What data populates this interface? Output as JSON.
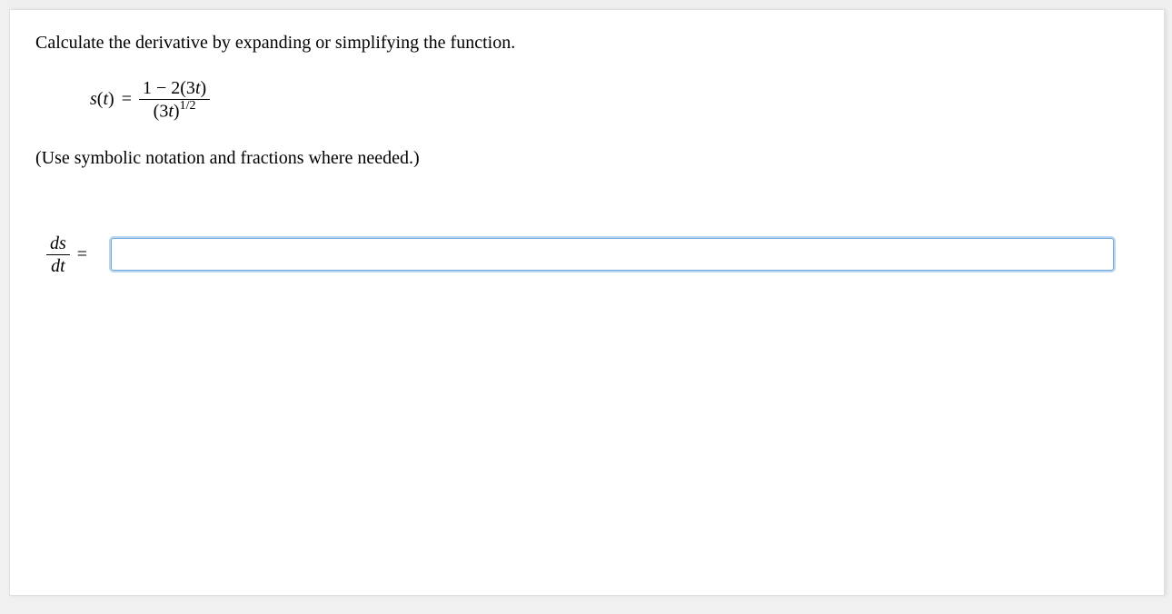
{
  "prompt": "Calculate the derivative by expanding or simplifying the function.",
  "equation": {
    "lhs": "s(t)",
    "eq": "=",
    "numerator_prefix": "1 − 2(3",
    "numerator_var": "t",
    "numerator_suffix": ")",
    "denominator_prefix": "(3",
    "denominator_var": "t",
    "denominator_close": ")",
    "denominator_exp": "1/2"
  },
  "note": "(Use symbolic notation and fractions where needed.)",
  "answer": {
    "label_num": "ds",
    "label_den": "dt",
    "eq": "=",
    "value": ""
  }
}
